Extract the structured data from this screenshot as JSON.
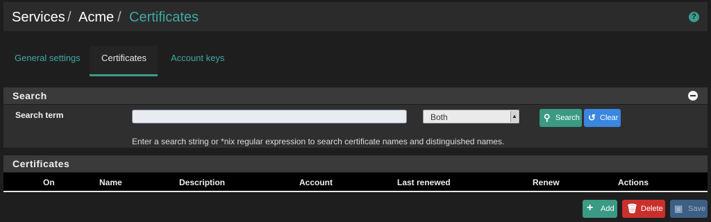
{
  "breadcrumb": {
    "items": [
      "Services",
      "Acme"
    ],
    "separator": "/",
    "current": "Certificates"
  },
  "help_icon": "question-circle-icon",
  "tabs": [
    {
      "label": "General settings",
      "active": false
    },
    {
      "label": "Certificates",
      "active": true
    },
    {
      "label": "Account keys",
      "active": false
    }
  ],
  "search_panel": {
    "title": "Search",
    "collapse_icon": "minus-circle-icon",
    "term_label": "Search term",
    "term_value": "",
    "scope_selected": "Both",
    "search_button": "Search",
    "clear_button": "Clear",
    "help_text": "Enter a search string or *nix regular expression to search certificate names and distinguished names."
  },
  "certificates_panel": {
    "title": "Certificates",
    "columns": [
      "On",
      "Name",
      "Description",
      "Account",
      "Last renewed",
      "Renew",
      "Actions"
    ],
    "rows": []
  },
  "actions": {
    "add": "Add",
    "delete": "Delete",
    "save": "Save"
  },
  "colors": {
    "accent": "#3c9c8c",
    "clear": "#3a86e0",
    "danger": "#c9302c",
    "save": "#3d5f84"
  }
}
